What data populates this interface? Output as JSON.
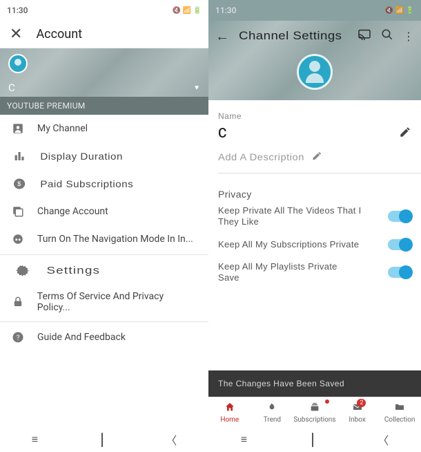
{
  "left": {
    "status": {
      "time": "11:30"
    },
    "header": {
      "title": "Account"
    },
    "user": {
      "letter": "C"
    },
    "section_label": "YOUTUBE PREMIUM",
    "menu": {
      "my_channel": "My Channel",
      "display_duration": "Display Duration",
      "paid_subscriptions": "Paid Subscriptions",
      "change_account": "Change Account",
      "incognito": "Turn On The Navigation Mode In In...",
      "settings": "Settings",
      "terms": "Terms Of Service And Privacy Policy...",
      "guide": "Guide And Feedback"
    }
  },
  "right": {
    "status": {
      "time": "11:30"
    },
    "header": {
      "title": "Channel Settings"
    },
    "name_label": "Name",
    "name_value": "C",
    "description_placeholder": "Add A Description",
    "privacy_title": "Privacy",
    "toggles": {
      "videos_liked": "Keep Private All The Videos That I They Like",
      "subscriptions": "Keep All My Subscriptions Private",
      "playlists": "Keep All My Playlists Private",
      "save": "Save"
    },
    "toast": "The Changes Have Been Saved",
    "nav": {
      "home": "Home",
      "trend": "Trend",
      "subscriptions": "Subscriptions",
      "inbox": "Inbox",
      "inbox_badge": "2",
      "collection": "Collection"
    }
  }
}
